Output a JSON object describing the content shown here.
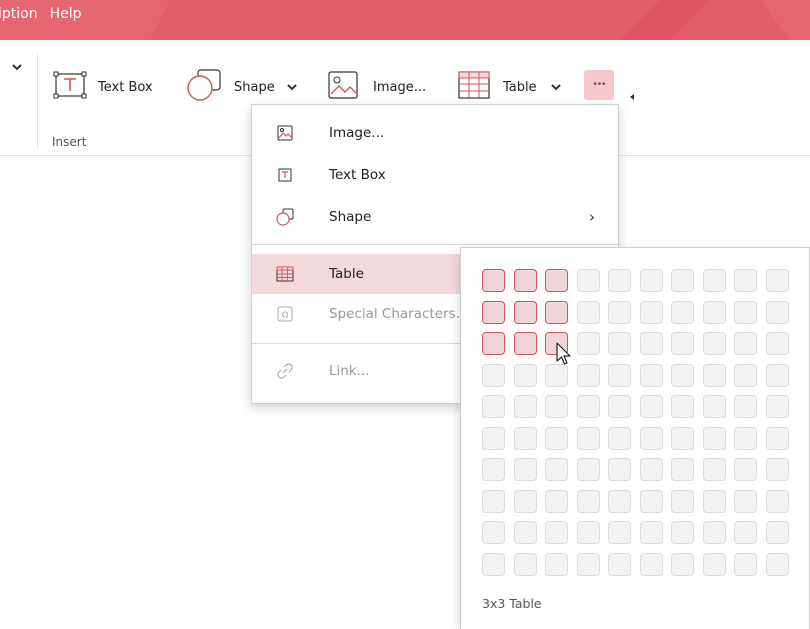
{
  "theme": {
    "accent": "#e6676f",
    "accent_light": "#f2d9db",
    "selected_cell": "#d0555e"
  },
  "titlebar": {
    "menu": [
      {
        "label": "iption"
      },
      {
        "label": "Help"
      }
    ]
  },
  "ribbon": {
    "buttons": {
      "textbox": {
        "label": "Text Box",
        "icon": "text-box-icon"
      },
      "shape": {
        "label": "Shape",
        "icon": "shape-icon"
      },
      "image": {
        "label": "Image...",
        "icon": "image-icon"
      },
      "table": {
        "label": "Table",
        "icon": "table-icon"
      },
      "more": {
        "label": "•••",
        "icon": "more-icon"
      }
    },
    "group_label": "Insert"
  },
  "dropdown": {
    "items": [
      {
        "label": "Image...",
        "icon": "image-icon",
        "enabled": true
      },
      {
        "label": "Text Box",
        "icon": "text-box-icon",
        "enabled": true
      },
      {
        "label": "Shape",
        "icon": "shape-icon",
        "enabled": true,
        "submenu": true
      },
      {
        "label": "Table",
        "icon": "table-icon",
        "enabled": true,
        "selected": true
      },
      {
        "label": "Special Characters...",
        "icon": "special-characters-icon",
        "enabled": false
      },
      {
        "label": "Link...",
        "icon": "link-icon",
        "enabled": false
      }
    ],
    "submenu_arrow": "›"
  },
  "table_picker": {
    "rows": 10,
    "cols": 10,
    "selected_rows": 3,
    "selected_cols": 3,
    "caption": "3x3 Table"
  }
}
